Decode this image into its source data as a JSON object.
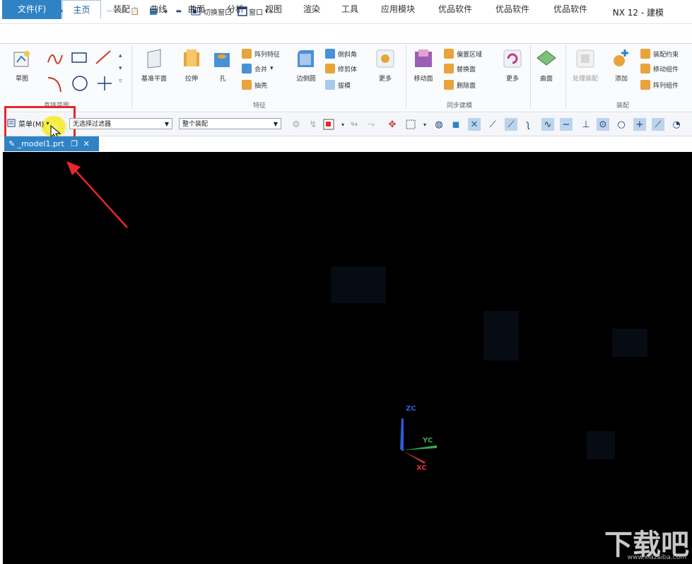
{
  "app": {
    "logo": "NX",
    "window_title": "NX 12 - 建模",
    "quick_access": {
      "switch_window_label": "切换窗口",
      "window_label": "窗口"
    }
  },
  "tabs": [
    "文件(F)",
    "主页",
    "装配",
    "曲线",
    "曲面",
    "分析",
    "视图",
    "渲染",
    "工具",
    "应用模块",
    "优品软件",
    "优品软件",
    "优品软件"
  ],
  "ribbon": {
    "sketch": {
      "label": "草图",
      "group_label": "直接草图"
    },
    "feature": {
      "datum_plane": "基准平面",
      "extrude": "拉伸",
      "hole": "孔",
      "pattern_feature": "阵列特征",
      "unite": "合并",
      "shell": "抽壳",
      "edge_blend": "边倒圆",
      "chamfer": "倒斜角",
      "trim_body": "修剪体",
      "draft": "拔模",
      "more": "更多",
      "group_label": "特征"
    },
    "sync": {
      "move_face": "移动面",
      "offset_region": "偏置区域",
      "replace_face": "替换面",
      "delete_face": "删除面",
      "more": "更多",
      "group_label": "同步建模"
    },
    "surface": {
      "label": "曲面"
    },
    "assembly": {
      "assembly_navigator": "处理装配",
      "add": "添加",
      "assembly_constraints": "装配约束",
      "move_component": "移动组件",
      "pattern_component": "阵列组件",
      "group_label": "装配"
    }
  },
  "toolbar": {
    "menu_label": "菜单(M)",
    "selection_filter": "无选择过滤器",
    "scope": "整个装配"
  },
  "document": {
    "tab_label": "_model1.prt"
  },
  "viewport": {
    "axes": {
      "z": "ZC",
      "y": "YC",
      "x": "XC"
    }
  },
  "watermark": {
    "logo": "下载吧",
    "url": "www.xiazaiba.com"
  },
  "colors": {
    "accent": "#2f83c5",
    "highlight": "#e8262d",
    "z_axis": "#2a5bd7",
    "y_axis": "#3aa84a",
    "x_axis": "#d8343b"
  }
}
